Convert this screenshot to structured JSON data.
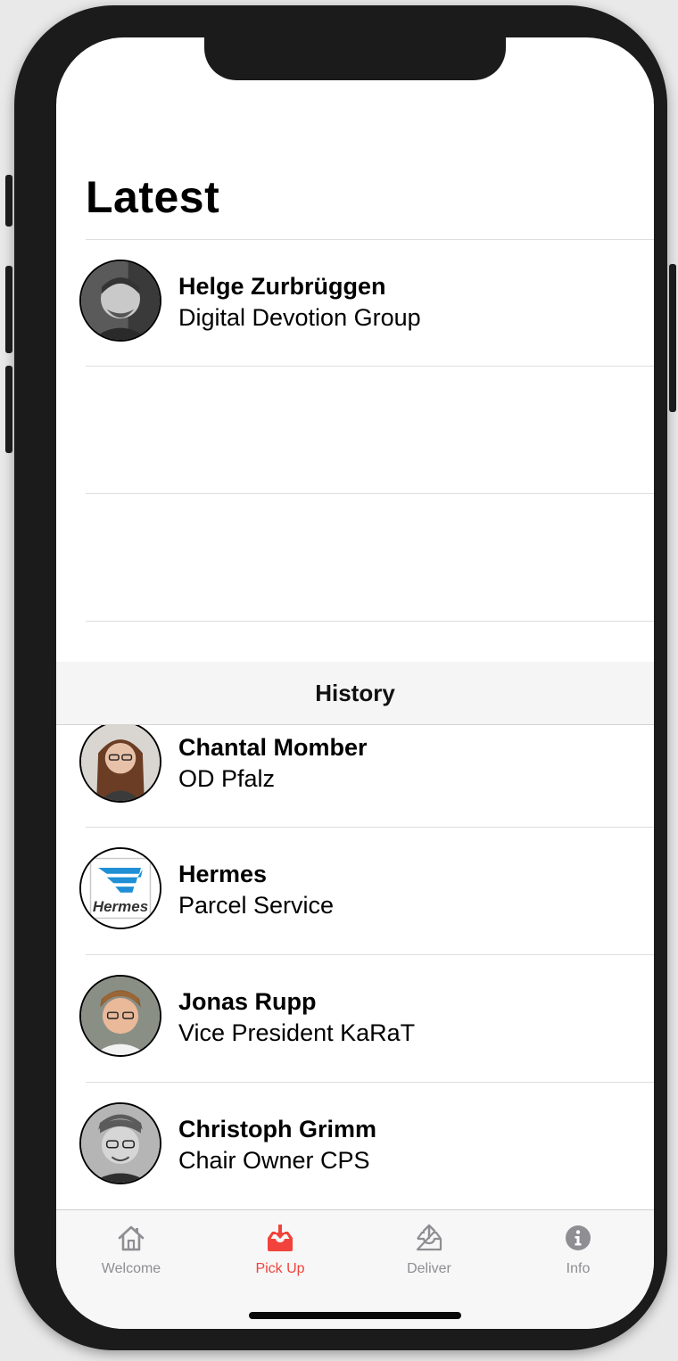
{
  "latest": {
    "title": "Latest",
    "items": [
      {
        "name": "Helge Zurbrüggen",
        "subtitle": "Digital Devotion Group",
        "avatar": "person-photo"
      }
    ]
  },
  "history": {
    "header": "History",
    "items": [
      {
        "name": "Chantal Momber",
        "subtitle": "OD Pfalz",
        "avatar": "person-photo"
      },
      {
        "name": "Hermes",
        "subtitle": "Parcel Service",
        "avatar": "hermes-logo",
        "logo_text": "Hermes"
      },
      {
        "name": "Jonas Rupp",
        "subtitle": "Vice President KaRaT",
        "avatar": "person-photo"
      },
      {
        "name": "Christoph Grimm",
        "subtitle": "Chair Owner CPS",
        "avatar": "person-photo"
      }
    ]
  },
  "tabbar": {
    "tabs": [
      {
        "label": "Welcome",
        "icon": "home-icon",
        "active": false
      },
      {
        "label": "Pick Up",
        "icon": "inbox-download-icon",
        "active": true
      },
      {
        "label": "Deliver",
        "icon": "outbox-upload-icon",
        "active": false
      },
      {
        "label": "Info",
        "icon": "info-icon",
        "active": false
      }
    ]
  },
  "colors": {
    "accent": "#f1433b",
    "inactive_tab": "#8e8e93",
    "section_header_bg": "#f5f5f5",
    "divider": "#dedede"
  }
}
